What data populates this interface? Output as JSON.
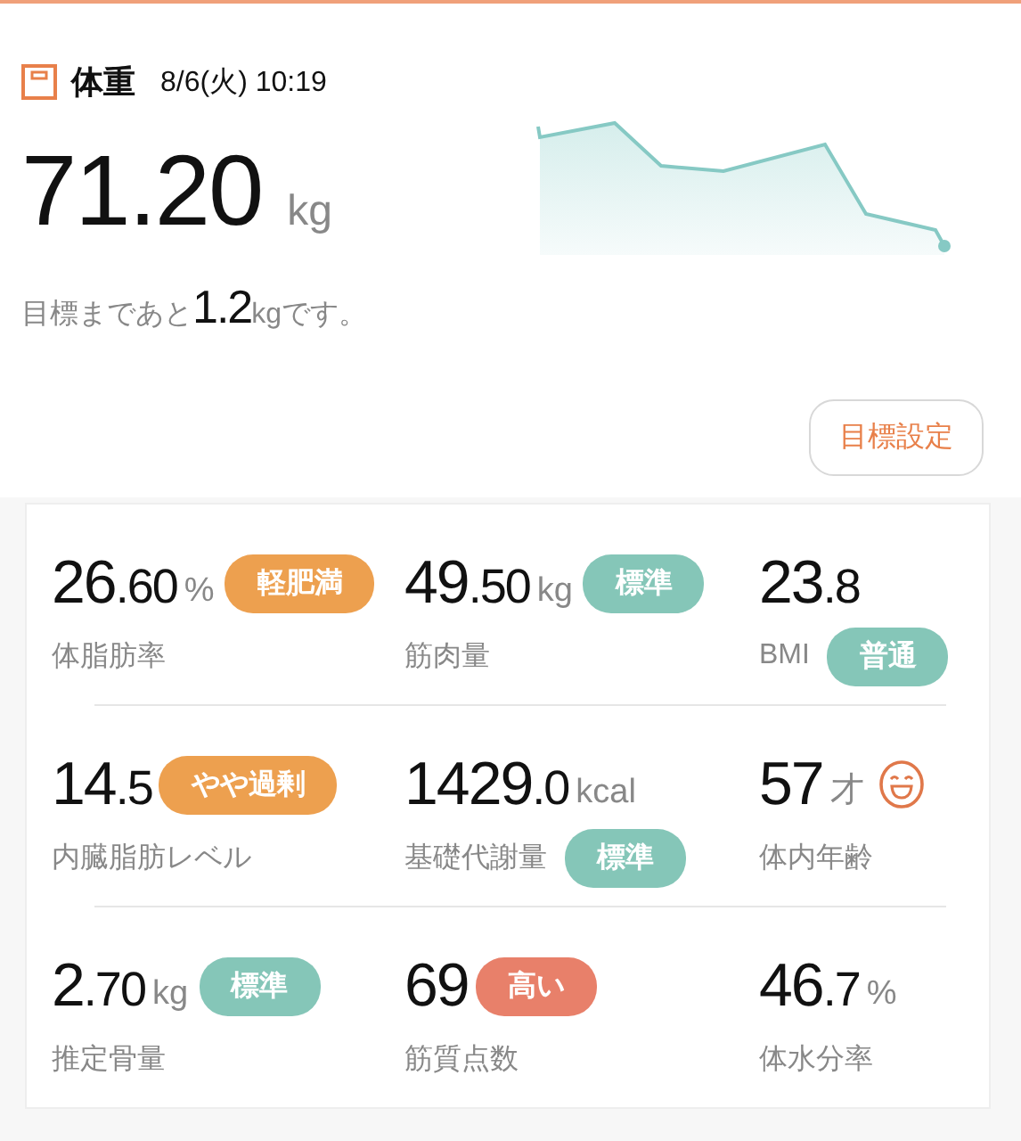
{
  "header": {
    "title": "体重",
    "datetime": "8/6(火) 10:19"
  },
  "weight": {
    "value": "71.20",
    "unit": "kg"
  },
  "goal_note": {
    "before": "目標まであと",
    "value": "1.2",
    "after": "kgです。"
  },
  "goal_button": "目標設定",
  "metrics": [
    [
      {
        "kind": "value_badge",
        "value": "26.60",
        "unit": "%",
        "label": "体脂肪率",
        "badge": {
          "text": "軽肥満",
          "color": "#eda04f"
        }
      },
      {
        "kind": "value_badge",
        "value": "49.50",
        "unit": "kg",
        "label": "筋肉量",
        "badge": {
          "text": "標準",
          "color": "#85c6b8"
        }
      },
      {
        "kind": "label_badge",
        "value": "23.8",
        "label": "BMI",
        "badge": {
          "text": "普通",
          "color": "#85c6b8"
        }
      }
    ],
    [
      {
        "kind": "value_badge",
        "value": "14.5",
        "label": "内臓脂肪レベル",
        "badge": {
          "text": "やや過剰",
          "color": "#eda04f"
        }
      },
      {
        "kind": "label_badge",
        "value": "1429.0",
        "unit": "kcal",
        "label": "基礎代謝量",
        "badge": {
          "text": "標準",
          "color": "#85c6b8"
        }
      },
      {
        "kind": "face",
        "value": "57",
        "unit": "才",
        "label": "体内年齢"
      }
    ],
    [
      {
        "kind": "value_badge",
        "value": "2.70",
        "unit": "kg",
        "label": "推定骨量",
        "badge": {
          "text": "標準",
          "color": "#85c6b8"
        }
      },
      {
        "kind": "value_badge",
        "value": "69",
        "label": "筋質点数",
        "badge": {
          "text": "高い",
          "color": "#e8806a"
        }
      },
      {
        "kind": "plain",
        "value": "46.7",
        "unit": "%",
        "label": "体水分率"
      }
    ]
  ]
}
